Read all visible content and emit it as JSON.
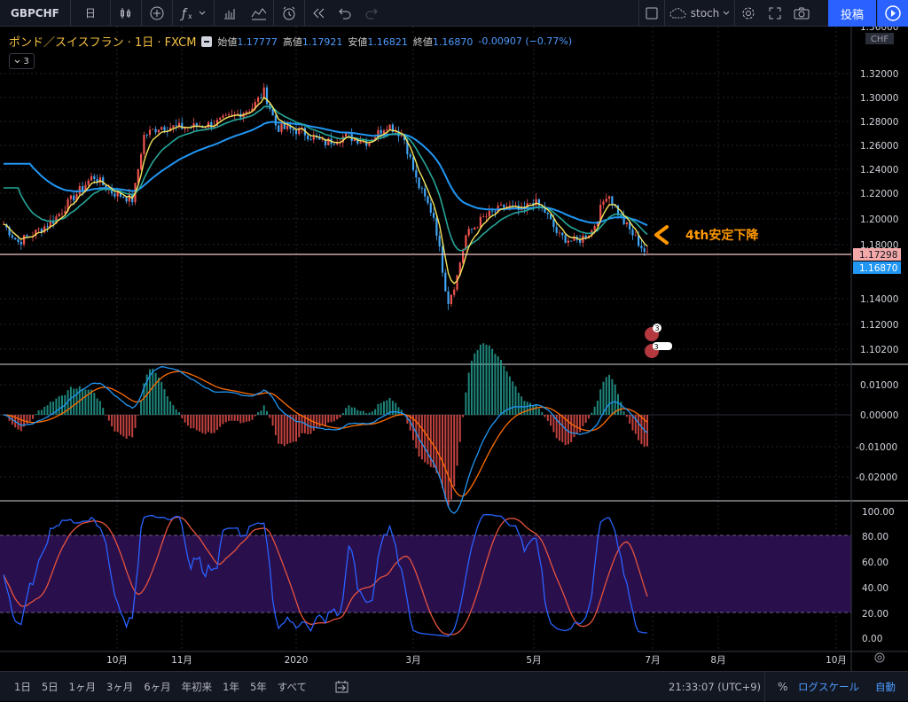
{
  "toolbar": {
    "symbol": "GBPCHF",
    "interval": "日",
    "indicator_search": "stoch",
    "post_label": "投稿"
  },
  "legend": {
    "title": "ポンド／スイスフラン · 1日 · FXCM",
    "open_label": "始値",
    "open": "1.17777",
    "high_label": "高値",
    "high": "1.17921",
    "low_label": "安値",
    "low": "1.16821",
    "close_label": "終値",
    "close": "1.16870",
    "change": "-0.00907 (−0.77%)",
    "collapsed_count": "3"
  },
  "annotation": "4th安定下降",
  "currency_badge": "CHF",
  "price_axis": {
    "ticks": [
      "1.36000",
      "1.32000",
      "1.30000",
      "1.28000",
      "1.26000",
      "1.24000",
      "1.22000",
      "1.20000",
      "1.18000",
      "1.14000",
      "1.12000",
      "1.10200"
    ],
    "horizontal_line_label": "1.17298",
    "last_price_label": "1.16870"
  },
  "macd_axis": {
    "ticks": [
      "0.01000",
      "0.00000",
      "-0.01000",
      "-0.02000"
    ]
  },
  "stoch_axis": {
    "ticks": [
      "100.00",
      "80.00",
      "60.00",
      "40.00",
      "20.00",
      "0.00"
    ]
  },
  "time_axis": {
    "ticks": [
      "10月",
      "11月",
      "2020",
      "3月",
      "5月",
      "7月",
      "8月",
      "10月"
    ]
  },
  "event_badges": [
    "3",
    "3"
  ],
  "bottom": {
    "ranges": [
      "1日",
      "5日",
      "1ヶ月",
      "3ヶ月",
      "6ヶ月",
      "年初来",
      "1年",
      "5年",
      "すべて"
    ],
    "clock": "21:33:07 (UTC+9)",
    "percent": "%",
    "log": "ログスケール",
    "auto": "自動"
  },
  "colors": {
    "up": "#ef5350",
    "down": "#42a5f5",
    "ma_fast": "#f5e35b",
    "ma_mid": "#26a69a",
    "ma_slow": "#2196f3",
    "macd": "#2196f3",
    "signal": "#ff6d00",
    "stoch_k": "#2962ff",
    "stoch_d": "#e5533d",
    "band": "#2a0f4d",
    "annotation": "#ff9800"
  }
}
